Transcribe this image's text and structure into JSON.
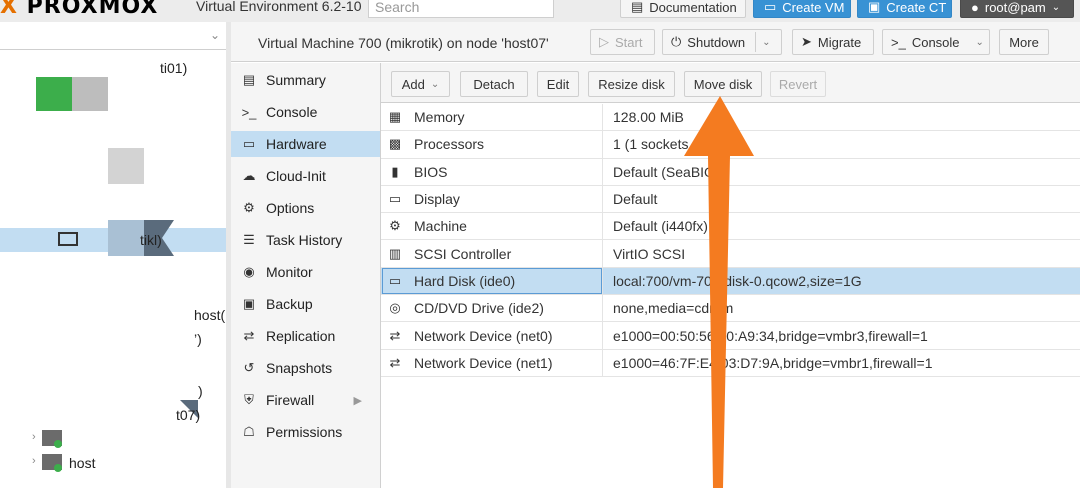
{
  "header": {
    "logo_text": "PROXMOX",
    "version": "Virtual Environment 6.2-10",
    "search_placeholder": "Search",
    "documentation": "Documentation",
    "create_vm": "Create VM",
    "create_ct": "Create CT",
    "user": "root@pam"
  },
  "tree": {
    "fragments": [
      "ti01)",
      "tikl)",
      "host(",
      "’)",
      ")",
      "t07)",
      "host"
    ]
  },
  "vm": {
    "title": "Virtual Machine 700 (mikrotik) on node 'host07'",
    "start": "Start",
    "shutdown": "Shutdown",
    "migrate": "Migrate",
    "console": "Console",
    "more": "More"
  },
  "nav": [
    {
      "label": "Summary",
      "icon": "book-icon",
      "glyph": "▤"
    },
    {
      "label": "Console",
      "icon": "terminal-icon",
      "glyph": ">_"
    },
    {
      "label": "Hardware",
      "icon": "monitor-icon",
      "glyph": "▭",
      "active": true
    },
    {
      "label": "Cloud-Init",
      "icon": "cloud-icon",
      "glyph": "☁"
    },
    {
      "label": "Options",
      "icon": "gear-icon",
      "glyph": "⚙"
    },
    {
      "label": "Task History",
      "icon": "list-icon",
      "glyph": "☰"
    },
    {
      "label": "Monitor",
      "icon": "eye-icon",
      "glyph": "◉"
    },
    {
      "label": "Backup",
      "icon": "floppy-icon",
      "glyph": "▣"
    },
    {
      "label": "Replication",
      "icon": "retweet-icon",
      "glyph": "⇄"
    },
    {
      "label": "Snapshots",
      "icon": "history-icon",
      "glyph": "↺"
    },
    {
      "label": "Firewall",
      "icon": "shield-icon",
      "glyph": "⛨",
      "submenu": true
    },
    {
      "label": "Permissions",
      "icon": "unlock-icon",
      "glyph": "☖"
    }
  ],
  "toolbar": {
    "add": "Add",
    "detach": "Detach",
    "edit": "Edit",
    "resize": "Resize disk",
    "move": "Move disk",
    "revert": "Revert"
  },
  "hardware": [
    {
      "key": "Memory",
      "value": "128.00 MiB",
      "icon": "memory-icon",
      "glyph": "▦"
    },
    {
      "key": "Processors",
      "value": "1 (1 sockets",
      "icon": "cpu-icon",
      "glyph": "▩"
    },
    {
      "key": "BIOS",
      "value": "Default (SeaBIO",
      "icon": "microchip-icon",
      "glyph": "▮"
    },
    {
      "key": "Display",
      "value": "Default",
      "icon": "desktop-icon",
      "glyph": "▭"
    },
    {
      "key": "Machine",
      "value": "Default (i440fx)",
      "icon": "cogs-icon",
      "glyph": "⚙"
    },
    {
      "key": "SCSI Controller",
      "value": "VirtIO SCSI",
      "icon": "database-icon",
      "glyph": "▥"
    },
    {
      "key": "Hard Disk (ide0)",
      "value": "local:700/vm-700-disk-0.qcow2,size=1G",
      "icon": "hdd-icon",
      "glyph": "▭",
      "selected": true
    },
    {
      "key": "CD/DVD Drive (ide2)",
      "value": "none,media=cdrom",
      "icon": "cdrom-icon",
      "glyph": "◎"
    },
    {
      "key": "Network Device (net0)",
      "value": "e1000=00:50:56:00:A9:34,bridge=vmbr3,firewall=1",
      "icon": "exchange-icon",
      "glyph": "⇄"
    },
    {
      "key": "Network Device (net1)",
      "value": "e1000=46:7F:E4:03:D7:9A,bridge=vmbr1,firewall=1",
      "icon": "exchange-icon",
      "glyph": "⇄"
    }
  ],
  "colors": {
    "accent_blue": "#3892d4",
    "selection": "#c2ddf2",
    "annotation_arrow": "#f47b20",
    "logo_orange": "#e57000"
  }
}
